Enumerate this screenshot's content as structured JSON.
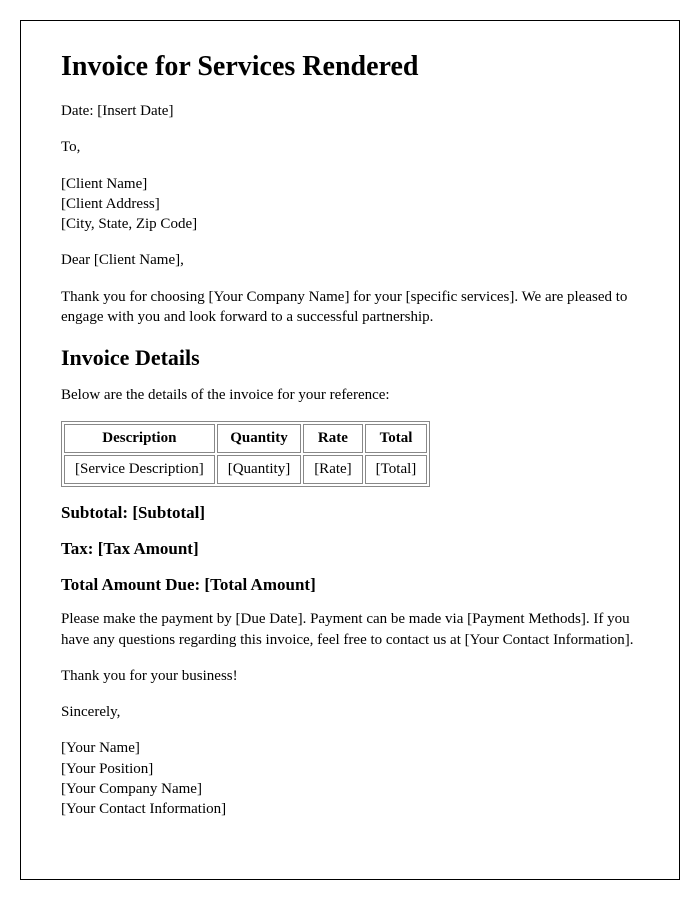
{
  "title": "Invoice for Services Rendered",
  "date_line": "Date: [Insert Date]",
  "to_label": "To,",
  "client": {
    "name": "[Client Name]",
    "address": "[Client Address]",
    "city_state_zip": "[City, State, Zip Code]"
  },
  "salutation": "Dear [Client Name],",
  "intro_paragraph": "Thank you for choosing [Your Company Name] for your [specific services]. We are pleased to engage with you and look forward to a successful partnership.",
  "details_heading": "Invoice Details",
  "details_intro": "Below are the details of the invoice for your reference:",
  "table": {
    "headers": [
      "Description",
      "Quantity",
      "Rate",
      "Total"
    ],
    "row": [
      "[Service Description]",
      "[Quantity]",
      "[Rate]",
      "[Total]"
    ]
  },
  "subtotal_line": "Subtotal: [Subtotal]",
  "tax_line": "Tax: [Tax Amount]",
  "total_due_line": "Total Amount Due: [Total Amount]",
  "payment_paragraph": "Please make the payment by [Due Date]. Payment can be made via [Payment Methods]. If you have any questions regarding this invoice, feel free to contact us at [Your Contact Information].",
  "thankyou": "Thank you for your business!",
  "closing": "Sincerely,",
  "sender": {
    "name": "[Your Name]",
    "position": "[Your Position]",
    "company": "[Your Company Name]",
    "contact": "[Your Contact Information]"
  }
}
